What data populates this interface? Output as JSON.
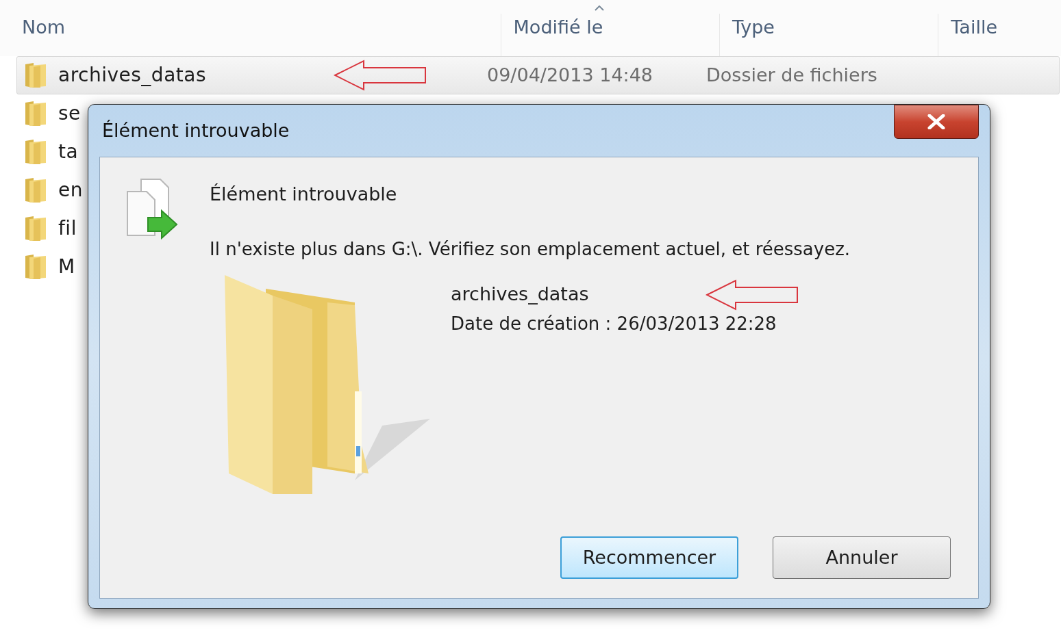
{
  "columns": [
    {
      "label": "Nom",
      "sorted": false
    },
    {
      "label": "Modifié le",
      "sorted": true
    },
    {
      "label": "Type",
      "sorted": false
    },
    {
      "label": "Taille",
      "sorted": false
    }
  ],
  "rows": [
    {
      "name": "archives_datas",
      "modified": "09/04/2013 14:48",
      "type": "Dossier de fichiers",
      "selected": true
    },
    {
      "name": "se",
      "selected": false
    },
    {
      "name": "ta",
      "selected": false
    },
    {
      "name": "en",
      "selected": false
    },
    {
      "name": "fil",
      "selected": false
    },
    {
      "name": "M",
      "selected": false
    }
  ],
  "dialog": {
    "title": "Élément introuvable",
    "heading": "Élément introuvable",
    "message": "Il n'existe plus dans G:\\. Vérifiez son emplacement actuel, et réessayez.",
    "item_name": "archives_datas",
    "item_detail": "Date de création : 26/03/2013 22:28",
    "buttons": [
      {
        "label": "Recommencer",
        "default": true
      },
      {
        "label": "Annuler",
        "default": false
      }
    ]
  }
}
